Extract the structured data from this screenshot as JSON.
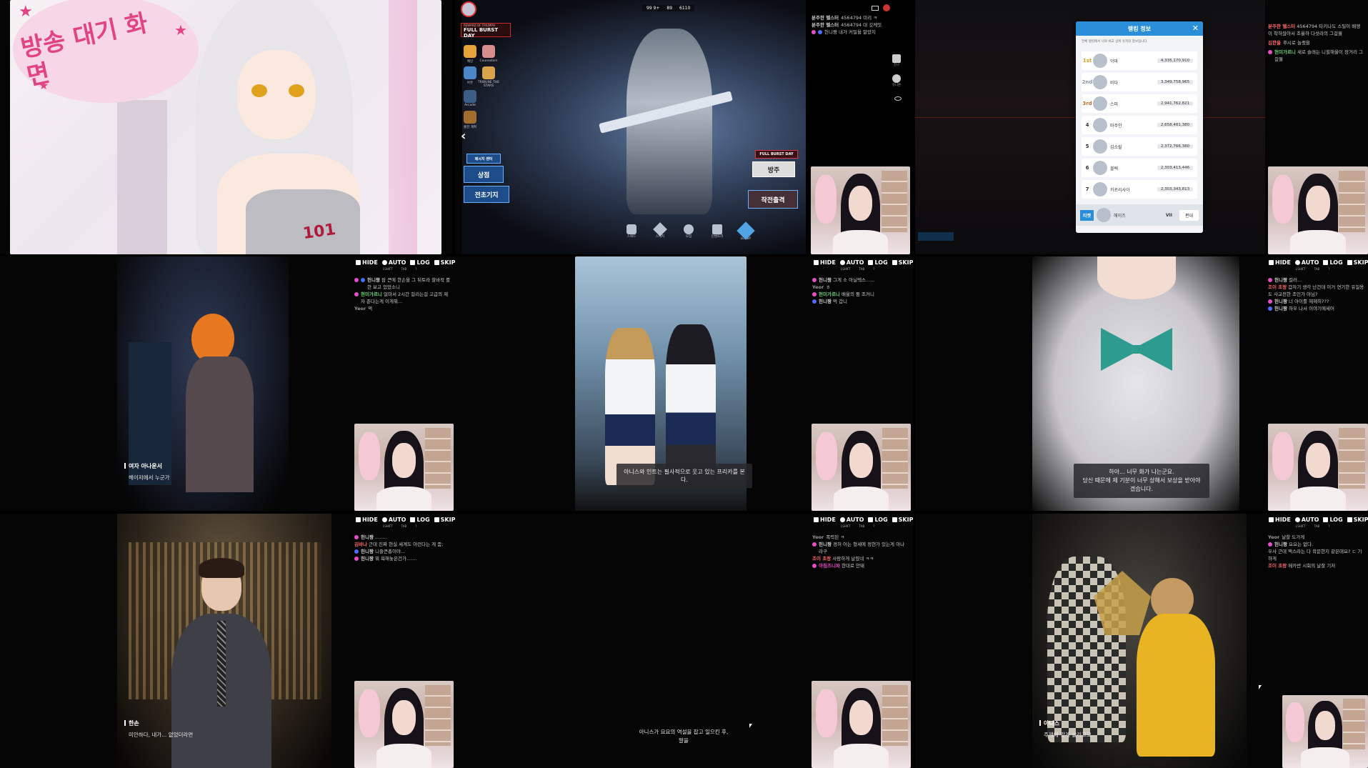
{
  "tile1": {
    "bubble_text": "방송 대기 화면",
    "jersey_number": "101"
  },
  "tile2": {
    "event_banner": "FULL BURST DAY",
    "event_banner_sub": "REWARD OF TRIUMPH",
    "side_menu": [
      "메인",
      "Counselors",
      "아웃",
      "TRIBUNE THE STARS",
      "Arcade",
      "출전 계획"
    ],
    "top_bar": [
      "99 9+",
      "89",
      "6110"
    ],
    "left_buttons": [
      "메시지 센터",
      "상점",
      "전초기지"
    ],
    "right_buttons": [
      "FULL BURST DAY",
      "방주",
      "작전출격"
    ],
    "bottom_nav": [
      "스쿼드",
      "스케치",
      "모집",
      "인벤토리",
      "LOBBY"
    ],
    "chat": [
      {
        "nick": "분주한 헬스터",
        "text": "4564794 미리 ㅋ"
      },
      {
        "nick": "분주한 헬스터",
        "text": "4564794 대 깃케잇"
      },
      {
        "nick": "",
        "text": "헌니짱 내가 커밀을 말았지"
      }
    ],
    "right_icons": [
      "친구",
      "유니온"
    ]
  },
  "tile3": {
    "modal_title": "랭킹 정보",
    "modal_sub": "전체 랭킹에서 나와 비교 상위 유저의 정보입니다.",
    "ranks": [
      {
        "no": "1st",
        "name": "악마",
        "score": "4,335,170,910"
      },
      {
        "no": "2nd",
        "name": "비다",
        "score": "3,349,758,965"
      },
      {
        "no": "3rd",
        "name": "스피",
        "score": "2,941,762,821"
      },
      {
        "no": "4",
        "name": "마주안",
        "score": "2,658,481,380"
      },
      {
        "no": "5",
        "name": "김소릴",
        "score": "2,372,766,380"
      },
      {
        "no": "6",
        "name": "블렉",
        "score": "2,303,413,446"
      },
      {
        "no": "7",
        "name": "카프리사아",
        "score": "2,303,343,813"
      }
    ],
    "my_rank": {
      "label": "티켓",
      "name": "헤이즈",
      "rank": "VII",
      "button": "편대"
    },
    "chat": [
      {
        "nick": "분주한 헬스터",
        "text": "4564794 타키나도 스틸이 배쟁이 착하잖아서 조율하 다섯라의 그걸뭘"
      },
      {
        "nick": "김한울",
        "text": "푸시로 놀랬을"
      },
      {
        "nick": "현미가르니",
        "text": "새로 슬레는 니힐해울이 장거리 그걸뭘"
      }
    ]
  },
  "tile4": {
    "controls": [
      "HIDE",
      "AUTO",
      "LOG",
      "SKIP"
    ],
    "control_keys": [
      "LSHIFT",
      "TAB",
      "?"
    ],
    "chat": [
      {
        "nick": "헌니짱",
        "text": "잠 큰에 한손을 그 뒤토라 찰바작 를 한 보고 있었소니"
      },
      {
        "nick": "현미가르니",
        "text": "얼마서 2시간 걸리는걸 고급의 제자 준다는게 이게뭐..."
      },
      {
        "nick": "Yeor",
        "text": "먹"
      }
    ],
    "speaker": "여자 아나운서",
    "line": "헤이저에서 누군가"
  },
  "tile5": {
    "controls": [
      "HIDE",
      "AUTO",
      "LOG",
      "SKIP"
    ],
    "control_keys": [
      "LSHIFT",
      "TAB",
      "?"
    ],
    "chat": [
      {
        "nick": "헌니짱",
        "text": "그게 소 아닐텍스......"
      },
      {
        "nick": "Yeor",
        "text": "ㅎ"
      },
      {
        "nick": "현미가르니",
        "text": "배울의 둠 조커니"
      },
      {
        "nick": "헌니짱",
        "text": "먹 갑니"
      }
    ],
    "subtitle": "아니스와 인트는 필사적으로 웃고 있는 프리카를 본다."
  },
  "tile6": {
    "controls": [
      "HIDE",
      "AUTO",
      "LOG",
      "SKIP"
    ],
    "control_keys": [
      "LSHIFT",
      "TAB",
      "?"
    ],
    "chat": [
      {
        "nick": "헌니짱",
        "text": "컬러..."
      },
      {
        "nick": "조이 초랑",
        "text": "갑자기 생각 난건데 이거 연기한 유일용도 사교전한 조인가 아님?"
      },
      {
        "nick": "헌니짱",
        "text": "너 아이를 헤헤히???"
      },
      {
        "nick": "헌니짱",
        "text": "하우 나서 이야기에세어"
      }
    ],
    "subtitle_1": "하아... 너무 화가 나는군요.",
    "subtitle_2": "당신 때문에 제 기분이 너무 상해서 보상을 받아야겠습니다."
  },
  "tile7": {
    "controls": [
      "HIDE",
      "AUTO",
      "LOG",
      "SKIP"
    ],
    "control_keys": [
      "LSHIFT",
      "TAB",
      "?"
    ],
    "chat": [
      {
        "nick": "헌니짱",
        "text": "........"
      },
      {
        "nick": "김바나",
        "text": "근데 진짜 현실 세계도 아런다는 게 좀;"
      },
      {
        "nick": "헌니짱",
        "text": "니즐큰총이야..."
      },
      {
        "nick": "헌니짱",
        "text": "뭐 욕해놓은건가......."
      }
    ],
    "speaker": "한손",
    "line": "미안하다, 내가... 없었더라면"
  },
  "tile8": {
    "controls": [
      "HIDE",
      "AUTO",
      "LOG",
      "SKIP"
    ],
    "control_keys": [
      "LSHIFT",
      "TAB",
      "?"
    ],
    "chat": [
      {
        "nick": "Yeor",
        "text": "폭력된 ㅋ"
      },
      {
        "nick": "헌니짱",
        "text": "경허 어는 형세에 정현가 있는게 아나라구"
      },
      {
        "nick": "조이 초랑",
        "text": "사람하게 날렸네 ㅋㅋ"
      },
      {
        "nick": "아침즈니파",
        "text": "한대로 안돼"
      }
    ],
    "subtitle_1": "아니스가 요요의 역설을 잡고 일으킨 후,",
    "subtitle_2": "말을"
  },
  "tile9": {
    "controls": [
      "HIDE",
      "AUTO",
      "LOG",
      "SKIP"
    ],
    "control_keys": [
      "LSHIFT",
      "TAB",
      "?"
    ],
    "chat": [
      {
        "nick": "Yeor",
        "text": "날찰 도가게"
      },
      {
        "nick": "헌니짱",
        "text": "요요는 없다."
      },
      {
        "nick": "",
        "text": "우사 근데 액스라는 다 학문한지 같은데요? ㄷ 기하게"
      },
      {
        "nick": "조이 초랑",
        "text": "메카반 시회의 날찰 기저"
      }
    ],
    "speaker": "아니스",
    "line": "주제에 맞게 살리고요."
  },
  "colors": {
    "ui_white": "#ffffff",
    "modal_header": "#2a8ed9",
    "badge_pink": "#e84cc8",
    "badge_blue": "#4e6cff",
    "nick_green": "#6fd07c",
    "nick_red": "#ff6a6a"
  }
}
